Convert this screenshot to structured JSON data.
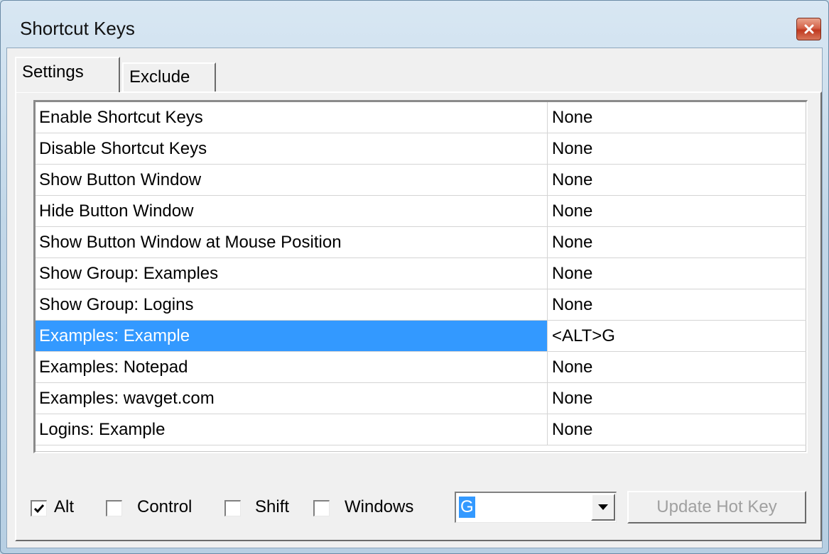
{
  "window": {
    "title": "Shortcut Keys",
    "close_icon": "close-icon"
  },
  "tabs": [
    {
      "label": "Settings",
      "active": true
    },
    {
      "label": "Exclude",
      "active": false
    }
  ],
  "table": {
    "rows": [
      {
        "action": "Enable Shortcut Keys",
        "key": "None"
      },
      {
        "action": "Disable Shortcut Keys",
        "key": "None"
      },
      {
        "action": "Show Button Window",
        "key": "None"
      },
      {
        "action": "Hide Button Window",
        "key": "None"
      },
      {
        "action": "Show Button Window at Mouse Position",
        "key": "None"
      },
      {
        "action": "Show Group: Examples",
        "key": "None"
      },
      {
        "action": "Show Group: Logins",
        "key": "None"
      },
      {
        "action": "Examples: Example",
        "key": "<ALT>G",
        "selected": true
      },
      {
        "action": "Examples: Notepad",
        "key": "None"
      },
      {
        "action": "Examples: wavget.com",
        "key": "None"
      },
      {
        "action": "Logins: Example",
        "key": "None"
      }
    ]
  },
  "modifiers": {
    "alt": {
      "label": "Alt",
      "checked": true
    },
    "control": {
      "label": "Control",
      "checked": false
    },
    "shift": {
      "label": "Shift",
      "checked": false
    },
    "windows": {
      "label": "Windows",
      "checked": false
    }
  },
  "key_select": {
    "value": "G"
  },
  "update_button": {
    "label": "Update Hot Key",
    "enabled": false
  },
  "colors": {
    "selection": "#3399ff",
    "disabled_text": "#a0a0a0"
  }
}
